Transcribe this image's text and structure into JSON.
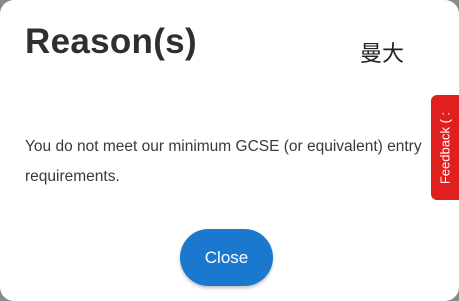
{
  "modal": {
    "title": "Reason(s)",
    "watermark": "曼大",
    "message": "You do not meet our minimum GCSE (or equivalent) entry requirements.",
    "close_label": "Close"
  },
  "feedback": {
    "label": "Feedback ( :"
  },
  "colors": {
    "button": "#1a79cf",
    "feedback_tab": "#e0201f"
  }
}
